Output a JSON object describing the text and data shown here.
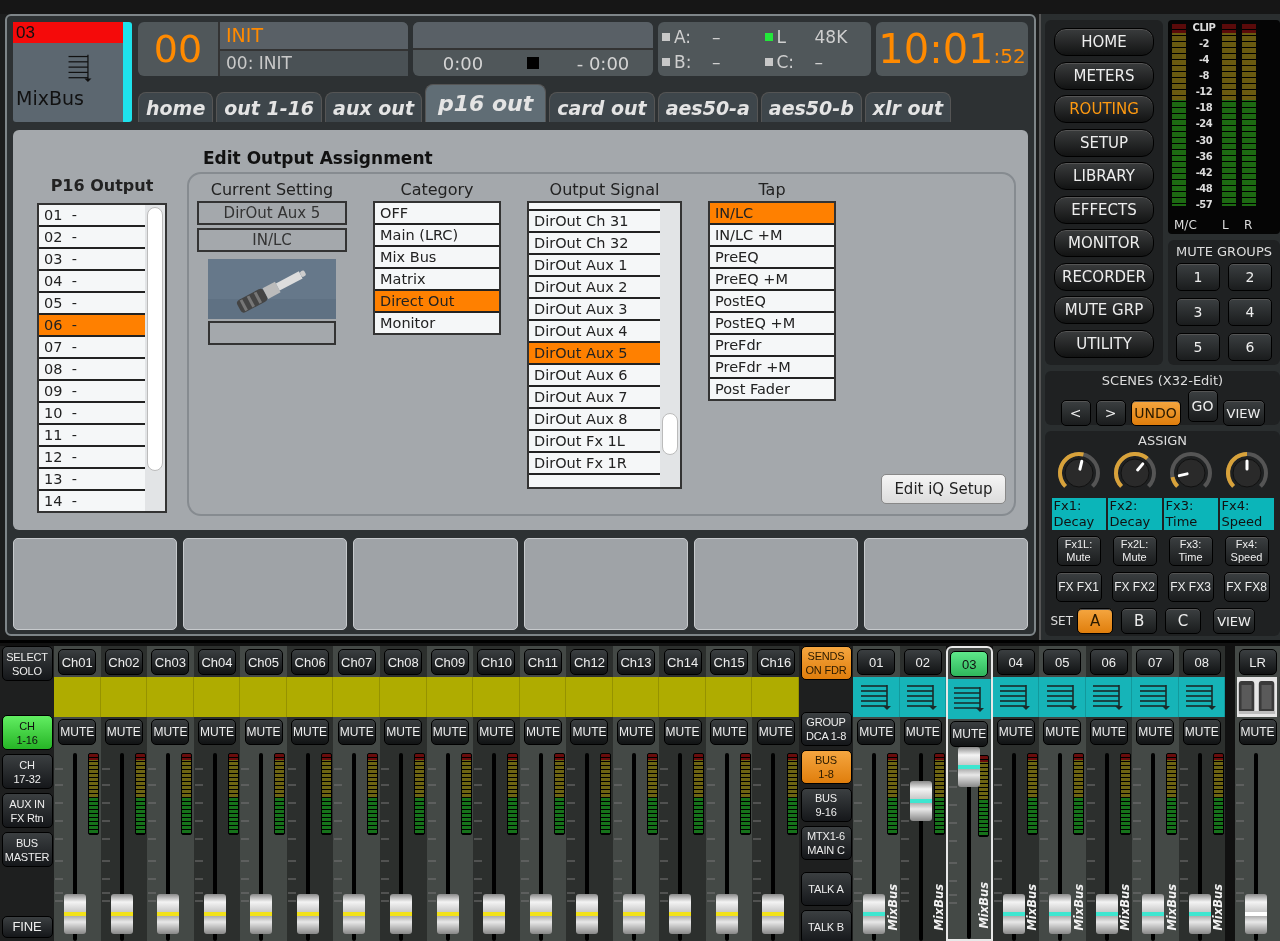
{
  "header": {
    "scribble": {
      "number": "03",
      "name": "MixBus"
    },
    "scene": {
      "number": "00",
      "name": "INIT",
      "detail": "00: INIT"
    },
    "transport": {
      "position": "0:00",
      "remaining": "- 0:00"
    },
    "status": [
      {
        "label": "A:",
        "value": "–",
        "on": false
      },
      {
        "label": "L",
        "value": "48K",
        "on": true
      },
      {
        "label": "B:",
        "value": "–",
        "on": false
      },
      {
        "label": "C:",
        "value": "–",
        "on": false
      }
    ],
    "clock": {
      "time": "10:01",
      "seconds": ":52"
    }
  },
  "tabs": [
    {
      "label": "home",
      "selected": false
    },
    {
      "label": "out 1-16",
      "selected": false
    },
    {
      "label": "aux out",
      "selected": false
    },
    {
      "label": "p16 out",
      "selected": true
    },
    {
      "label": "card out",
      "selected": false
    },
    {
      "label": "aes50-a",
      "selected": false
    },
    {
      "label": "aes50-b",
      "selected": false
    },
    {
      "label": "xlr out",
      "selected": false
    }
  ],
  "routing": {
    "title": "Edit Output Assignment",
    "outputs": {
      "title": "P16 Output",
      "items": [
        {
          "number": "01",
          "value": "-",
          "selected": false
        },
        {
          "number": "02",
          "value": "-",
          "selected": false
        },
        {
          "number": "03",
          "value": "-",
          "selected": false
        },
        {
          "number": "04",
          "value": "-",
          "selected": false
        },
        {
          "number": "05",
          "value": "-",
          "selected": false
        },
        {
          "number": "06",
          "value": "-",
          "selected": true
        },
        {
          "number": "07",
          "value": "-",
          "selected": false
        },
        {
          "number": "08",
          "value": "-",
          "selected": false
        },
        {
          "number": "09",
          "value": "-",
          "selected": false
        },
        {
          "number": "10",
          "value": "-",
          "selected": false
        },
        {
          "number": "11",
          "value": "-",
          "selected": false
        },
        {
          "number": "12",
          "value": "-",
          "selected": false
        },
        {
          "number": "13",
          "value": "-",
          "selected": false
        },
        {
          "number": "14",
          "value": "-",
          "selected": false
        }
      ]
    },
    "current": {
      "title": "Current Setting",
      "signal": "DirOut Aux 5",
      "tap": "IN/LC"
    },
    "category": {
      "title": "Category",
      "items": [
        {
          "label": "OFF",
          "selected": false
        },
        {
          "label": "Main (LRC)",
          "selected": false
        },
        {
          "label": "Mix Bus",
          "selected": false
        },
        {
          "label": "Matrix",
          "selected": false
        },
        {
          "label": "Direct Out",
          "selected": true
        },
        {
          "label": "Monitor",
          "selected": false
        }
      ]
    },
    "signal": {
      "title": "Output Signal",
      "items": [
        {
          "label": "DirOut Ch 31",
          "selected": false
        },
        {
          "label": "DirOut Ch 32",
          "selected": false
        },
        {
          "label": "DirOut Aux 1",
          "selected": false
        },
        {
          "label": "DirOut Aux 2",
          "selected": false
        },
        {
          "label": "DirOut Aux 3",
          "selected": false
        },
        {
          "label": "DirOut Aux 4",
          "selected": false
        },
        {
          "label": "DirOut Aux 5",
          "selected": true
        },
        {
          "label": "DirOut Aux 6",
          "selected": false
        },
        {
          "label": "DirOut Aux 7",
          "selected": false
        },
        {
          "label": "DirOut Aux 8",
          "selected": false
        },
        {
          "label": "DirOut Fx 1L",
          "selected": false
        },
        {
          "label": "DirOut Fx 1R",
          "selected": false
        }
      ]
    },
    "tap": {
      "title": "Tap",
      "items": [
        {
          "label": "IN/LC",
          "selected": true
        },
        {
          "label": "IN/LC +M",
          "selected": false
        },
        {
          "label": "PreEQ",
          "selected": false
        },
        {
          "label": "PreEQ +M",
          "selected": false
        },
        {
          "label": "PostEQ",
          "selected": false
        },
        {
          "label": "PostEQ +M",
          "selected": false
        },
        {
          "label": "PreFdr",
          "selected": false
        },
        {
          "label": "PreFdr +M",
          "selected": false
        },
        {
          "label": "Post Fader",
          "selected": false
        }
      ]
    },
    "iq_button": "Edit iQ Setup"
  },
  "nav": [
    {
      "label": "HOME",
      "selected": false
    },
    {
      "label": "METERS",
      "selected": false
    },
    {
      "label": "ROUTING",
      "selected": true
    },
    {
      "label": "SETUP",
      "selected": false
    },
    {
      "label": "LIBRARY",
      "selected": false
    },
    {
      "label": "EFFECTS",
      "selected": false
    },
    {
      "label": "MONITOR",
      "selected": false
    },
    {
      "label": "RECORDER",
      "selected": false
    },
    {
      "label": "MUTE GRP",
      "selected": false
    },
    {
      "label": "UTILITY",
      "selected": false
    }
  ],
  "meters": {
    "scale": [
      "CLIP",
      "-2",
      "-4",
      "-8",
      "-12",
      "-18",
      "-24",
      "-30",
      "-36",
      "-42",
      "-48",
      "-57"
    ],
    "labels": [
      "M/C",
      "L",
      "R"
    ]
  },
  "mute_groups": {
    "title": "MUTE GROUPS",
    "buttons": [
      "1",
      "2",
      "3",
      "4",
      "5",
      "6"
    ]
  },
  "scenes": {
    "title": "SCENES (X32-Edit)",
    "buttons": [
      {
        "label": "<",
        "on": false
      },
      {
        "label": ">",
        "on": false
      },
      {
        "label": "UNDO",
        "on": true
      },
      {
        "label": "GO",
        "on": false
      },
      {
        "label": "VIEW",
        "on": false
      }
    ]
  },
  "assign": {
    "title": "ASSIGN",
    "knobs": [
      {
        "label": "Fx1:\nDecay"
      },
      {
        "label": "Fx2:\nDecay"
      },
      {
        "label": "Fx3:\nTime"
      },
      {
        "label": "Fx4:\nSpeed"
      }
    ],
    "buttons": [
      "Fx1L:\nMute",
      "Fx2L:\nMute",
      "Fx3:\nTime",
      "Fx4:\nSpeed"
    ],
    "fx_buttons": [
      "FX FX1",
      "FX FX2",
      "FX FX3",
      "FX FX8"
    ],
    "set_label": "SET",
    "sets": [
      {
        "label": "A",
        "selected": true
      },
      {
        "label": "B",
        "selected": false
      },
      {
        "label": "C",
        "selected": false
      }
    ],
    "view": "VIEW"
  },
  "mixer": {
    "layers": [
      {
        "label": "SELECT\nSOLO",
        "selected": false
      },
      {
        "label": "CH\n1-16",
        "selected": true
      },
      {
        "label": "CH\n17-32",
        "selected": false
      },
      {
        "label": "AUX IN\nFX Rtn",
        "selected": false
      },
      {
        "label": "BUS\nMASTER",
        "selected": false
      }
    ],
    "fine": "FINE",
    "channels": [
      {
        "kind": "channel",
        "name": "Ch01",
        "mute": "MUTE",
        "selected": false
      },
      {
        "kind": "channel",
        "name": "Ch02",
        "mute": "MUTE",
        "selected": false
      },
      {
        "kind": "channel",
        "name": "Ch03",
        "mute": "MUTE",
        "selected": false
      },
      {
        "kind": "channel",
        "name": "Ch04",
        "mute": "MUTE",
        "selected": false
      },
      {
        "kind": "channel",
        "name": "Ch05",
        "mute": "MUTE",
        "selected": false
      },
      {
        "kind": "channel",
        "name": "Ch06",
        "mute": "MUTE",
        "selected": false
      },
      {
        "kind": "channel",
        "name": "Ch07",
        "mute": "MUTE",
        "selected": false
      },
      {
        "kind": "channel",
        "name": "Ch08",
        "mute": "MUTE",
        "selected": false
      },
      {
        "kind": "channel",
        "name": "Ch09",
        "mute": "MUTE",
        "selected": false
      },
      {
        "kind": "channel",
        "name": "Ch10",
        "mute": "MUTE",
        "selected": false
      },
      {
        "kind": "channel",
        "name": "Ch11",
        "mute": "MUTE",
        "selected": false
      },
      {
        "kind": "channel",
        "name": "Ch12",
        "mute": "MUTE",
        "selected": false
      },
      {
        "kind": "channel",
        "name": "Ch13",
        "mute": "MUTE",
        "selected": false
      },
      {
        "kind": "channel",
        "name": "Ch14",
        "mute": "MUTE",
        "selected": false
      },
      {
        "kind": "channel",
        "name": "Ch15",
        "mute": "MUTE",
        "selected": false
      },
      {
        "kind": "channel",
        "name": "Ch16",
        "mute": "MUTE",
        "selected": false
      }
    ],
    "controls": [
      {
        "label": "SENDS\nON FDR",
        "on": true
      },
      {
        "label": "GROUP\nDCA 1-8",
        "on": false
      },
      {
        "label": "BUS\n1-8",
        "on": true
      },
      {
        "label": "BUS\n9-16",
        "on": false
      },
      {
        "label": "MTX1-6\nMAIN C",
        "on": false
      },
      {
        "label": "TALK A",
        "on": false
      },
      {
        "label": "TALK B",
        "on": false
      }
    ],
    "buses": [
      {
        "kind": "bus",
        "name": "01",
        "mute": "MUTE",
        "label": "MixBus",
        "selected": false
      },
      {
        "kind": "bus",
        "name": "02",
        "mute": "MUTE",
        "label": "MixBus",
        "selected": false
      },
      {
        "kind": "bus",
        "name": "03",
        "mute": "MUTE",
        "label": "MixBus",
        "selected": true
      },
      {
        "kind": "bus",
        "name": "04",
        "mute": "MUTE",
        "label": "MixBus",
        "selected": false
      },
      {
        "kind": "bus",
        "name": "05",
        "mute": "MUTE",
        "label": "MixBus",
        "selected": false
      },
      {
        "kind": "bus",
        "name": "06",
        "mute": "MUTE",
        "label": "MixBus",
        "selected": false
      },
      {
        "kind": "bus",
        "name": "07",
        "mute": "MUTE",
        "label": "MixBus",
        "selected": false
      },
      {
        "kind": "bus",
        "name": "08",
        "mute": "MUTE",
        "label": "MixBus",
        "selected": false
      }
    ],
    "main": {
      "kind": "main",
      "name": "LR",
      "mute": "MUTE",
      "selected": false
    }
  }
}
